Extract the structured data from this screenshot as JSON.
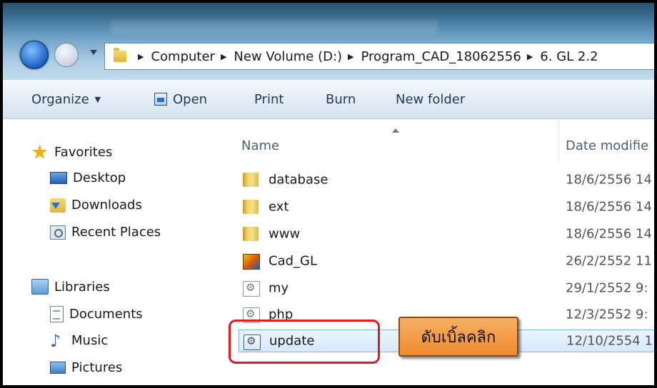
{
  "address": {
    "crumbs": [
      "Computer",
      "New Volume (D:)",
      "Program_CAD_18062556",
      "6. GL 2.2"
    ]
  },
  "toolbar": {
    "organize_label": "Organize",
    "open_label": "Open",
    "print_label": "Print",
    "burn_label": "Burn",
    "new_folder_label": "New folder"
  },
  "sidebar": {
    "favorites_label": "Favorites",
    "favorites": [
      "Desktop",
      "Downloads",
      "Recent Places"
    ],
    "libraries_label": "Libraries",
    "libraries": [
      "Documents",
      "Music",
      "Pictures"
    ]
  },
  "columns": {
    "name": "Name",
    "date": "Date modifie"
  },
  "files": [
    {
      "name": "database",
      "date": "18/6/2556 14",
      "icon": "folder-icon"
    },
    {
      "name": "ext",
      "date": "18/6/2556 14",
      "icon": "folder-icon"
    },
    {
      "name": "www",
      "date": "18/6/2556 14",
      "icon": "folder-icon"
    },
    {
      "name": "Cad_GL",
      "date": "26/2/2552 11",
      "icon": "cad-shortcut-icon"
    },
    {
      "name": "my",
      "date": "29/1/2552 9:",
      "icon": "config-file-icon"
    },
    {
      "name": "php",
      "date": "12/3/2552 9:",
      "icon": "config-file-icon"
    },
    {
      "name": "update",
      "date": "12/10/2554 1",
      "icon": "batch-file-icon",
      "selected": true
    }
  ],
  "annotation": {
    "callout_text": "ดับเบิ้ลคลิก"
  },
  "colors": {
    "highlight_border": "#e11b1b",
    "callout_fill": "#f08a2e",
    "selection": "#d6e9fb"
  }
}
